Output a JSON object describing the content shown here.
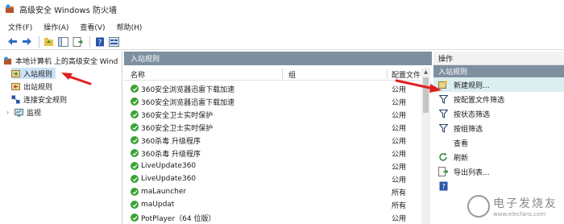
{
  "window": {
    "title": "高级安全 Windows 防火墙"
  },
  "menu": [
    "文件(F)",
    "操作(A)",
    "查看(V)",
    "帮助(H)"
  ],
  "toolbar": {
    "icons": [
      "back-arrow-icon",
      "forward-arrow-icon",
      "up-folder-icon",
      "show-hide-tree-icon",
      "export-icon",
      "help-icon",
      "properties-icon"
    ]
  },
  "tree": {
    "root": "本地计算机 上的高级安全 Wind",
    "children": [
      "入站规则",
      "出站规则",
      "连接安全规则",
      "监视"
    ]
  },
  "rules_pane": {
    "header": "入站规则",
    "columns": [
      "名称",
      "组",
      "配置文件"
    ],
    "rows": [
      {
        "name": "360安全浏览器迅雷下载加速",
        "profile": "公用"
      },
      {
        "name": "360安全浏览器迅雷下载加速",
        "profile": "公用"
      },
      {
        "name": "360安全卫士实时保护",
        "profile": "公用"
      },
      {
        "name": "360安全卫士实时保护",
        "profile": "公用"
      },
      {
        "name": "360杀毒 升级程序",
        "profile": "公用"
      },
      {
        "name": "360杀毒 升级程序",
        "profile": "公用"
      },
      {
        "name": "LiveUpdate360",
        "profile": "公用"
      },
      {
        "name": "LiveUpdate360",
        "profile": "公用"
      },
      {
        "name": "maLauncher",
        "profile": "所有"
      },
      {
        "name": "maUpdat",
        "profile": "所有"
      },
      {
        "name": "PotPlayer（64 位版）",
        "profile": "公用"
      }
    ]
  },
  "actions": {
    "title": "操作",
    "section": "入站规则",
    "items": [
      {
        "label": "新建规则...",
        "icon": "new-rule-icon"
      },
      {
        "label": "按配置文件筛选",
        "icon": "filter-icon"
      },
      {
        "label": "按状态筛选",
        "icon": "filter-icon"
      },
      {
        "label": "按组筛选",
        "icon": "filter-icon"
      },
      {
        "label": "查看",
        "icon": ""
      },
      {
        "label": "刷新",
        "icon": "refresh-icon"
      },
      {
        "label": "导出列表...",
        "icon": "export-list-icon"
      },
      {
        "label": "",
        "icon": "help-icon"
      }
    ]
  },
  "watermark": {
    "cn": "电子发烧友",
    "url": "www.elecfans.com"
  },
  "colors": {
    "pane_header": "#7e8fa0",
    "selection": "#cde3f7",
    "enabled_check": "#3aa335",
    "annotation_arrow": "#e02020"
  }
}
